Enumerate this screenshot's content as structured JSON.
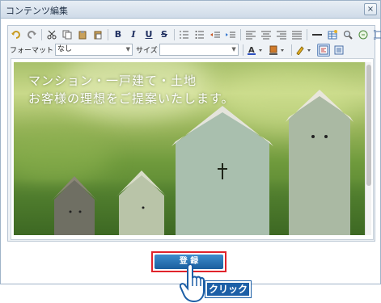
{
  "dialog": {
    "title": "コンテンツ編集",
    "close_label": "×"
  },
  "toolbar": {
    "format_label": "フォーマット",
    "format_value": "なし",
    "size_label": "サイズ",
    "size_value": "",
    "bold": "B",
    "italic": "I",
    "underline": "U",
    "strike": "S"
  },
  "content": {
    "headline_line1": "マンション・一戸建て・土地",
    "headline_line2": "お客様の理想をご提案いたします。"
  },
  "footer": {
    "save_label": "登 録",
    "click_label": "クリック"
  },
  "colors": {
    "accent": "#1a5f9e",
    "highlight": "#e0232b"
  }
}
